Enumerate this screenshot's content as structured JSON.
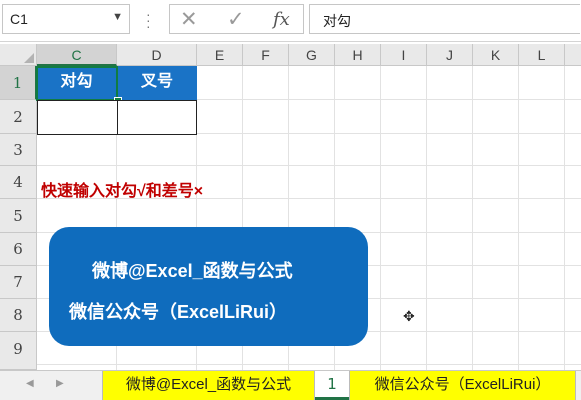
{
  "formula_bar": {
    "name_box": "C1",
    "cancel_symbol": "✕",
    "enter_symbol": "✓",
    "fx_label": "fx",
    "formula": "对勾"
  },
  "columns": [
    "C",
    "D",
    "E",
    "F",
    "G",
    "H",
    "I",
    "J",
    "K",
    "L"
  ],
  "rows": [
    "1",
    "2",
    "3",
    "4",
    "5",
    "6",
    "7",
    "8",
    "9"
  ],
  "cells": {
    "C1": "对勾",
    "D1": "叉号",
    "C4": "快速输入对勾√和差号×"
  },
  "banner": {
    "line1": "微博@Excel_函数与公式",
    "line2": "微信公众号（ExcelLiRui）"
  },
  "sheet_tabs": [
    {
      "label": "微博@Excel_函数与公式",
      "active": false
    },
    {
      "label": "1",
      "active": true
    },
    {
      "label": "微信公众号（ExcelLiRui）",
      "active": false
    }
  ],
  "colors": {
    "header_fill": "#1a73c6",
    "selection": "#107c41",
    "red_text": "#c00000",
    "banner": "#0f6cbd",
    "tab_highlight": "#ffff00"
  }
}
